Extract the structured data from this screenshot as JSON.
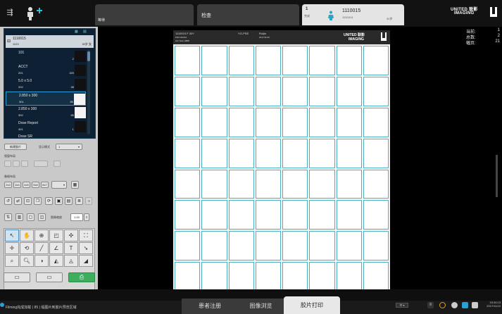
{
  "topbar": {
    "tab_wait": "等待",
    "tab_exam": "检查",
    "patient_tab": {
      "number": "1",
      "sub": "完成",
      "id": "1110015",
      "id_sub": "11111111",
      "age": "30岁"
    },
    "logo_line1": "UNITED 联影",
    "logo_line2": "IMAGING"
  },
  "left": {
    "patient_card": {
      "id": "1110015",
      "sub": "1123",
      "age_sex": "30岁 女"
    },
    "series": [
      {
        "name": "101",
        "sub": "",
        "count": "2 幅"
      },
      {
        "name": "ACCT",
        "sub": "201",
        "count": "159 幅"
      },
      {
        "name": "5.0 x 5.0",
        "sub": "202",
        "count": "48 幅"
      },
      {
        "name": "2.850 x 300",
        "sub": "301",
        "count": "85 幅"
      },
      {
        "name": "2.850 x 300",
        "sub": "302",
        "count": "85 幅"
      },
      {
        "name": "Dose Report",
        "sub": "401",
        "count": "1 幅"
      },
      {
        "name": "Dose SR",
        "sub": "",
        "count": ""
      }
    ],
    "new_film_button": "新建胶片",
    "display_mode_label": "显示模式",
    "display_mode_value": "1",
    "view_layout_label": "视窗布局",
    "image_layout_label": "像格布局",
    "layouts": [
      "2x3",
      "3x4",
      "4x5",
      "5x6",
      "6x7"
    ],
    "zoom_label": "图像缩放",
    "zoom_value": "1.00"
  },
  "film": {
    "h1": "1110015  F  30Y",
    "h2": "PID:1111111",
    "h3": "Acc Num:2888",
    "h4": "YG-PSE",
    "h5": "Ruijin",
    "h6": "2017/11/10",
    "logo1": "UNITED 联影",
    "logo2": "IMAGING"
  },
  "info": {
    "current_label": "当前:",
    "current_value": "1",
    "total_label": "总数:",
    "total_value": "2",
    "frames_label": "幅页:",
    "frames_value": "21"
  },
  "bottom": {
    "status_text": "Filming完成加载 ( 85 ) 幅图片到胶片预览区域",
    "tabs": [
      "患者注册",
      "图像浏览",
      "胶片打印"
    ],
    "time": "15:34:13",
    "date": "2017/11/10"
  },
  "colors": {
    "accent": "#2a9fd6",
    "film_border": "#4bb0c2",
    "print_button": "#3dae5e"
  }
}
